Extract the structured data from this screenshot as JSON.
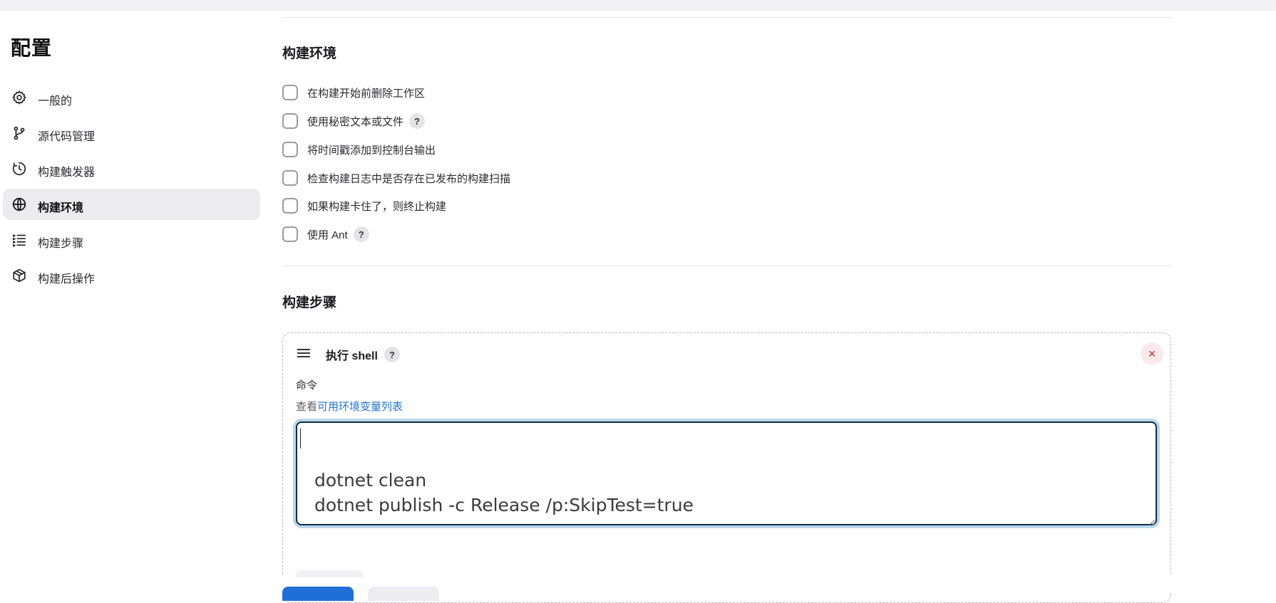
{
  "sidebar": {
    "title": "配置",
    "items": [
      {
        "label": "一般的",
        "icon": "gear-icon",
        "active": false
      },
      {
        "label": "源代码管理",
        "icon": "git-branch-icon",
        "active": false
      },
      {
        "label": "构建触发器",
        "icon": "clock-icon",
        "active": false
      },
      {
        "label": "构建环境",
        "icon": "globe-icon",
        "active": true
      },
      {
        "label": "构建步骤",
        "icon": "list-steps-icon",
        "active": false
      },
      {
        "label": "构建后操作",
        "icon": "package-icon",
        "active": false
      }
    ]
  },
  "build_env": {
    "title": "构建环境",
    "options": [
      {
        "label": "在构建开始前删除工作区",
        "checked": false,
        "help": false
      },
      {
        "label": "使用秘密文本或文件",
        "checked": false,
        "help": true
      },
      {
        "label": "将时间戳添加到控制台输出",
        "checked": false,
        "help": false
      },
      {
        "label": "检查构建日志中是否存在已发布的构建扫描",
        "checked": false,
        "help": false
      },
      {
        "label": "如果构建卡住了，则终止构建",
        "checked": false,
        "help": false
      },
      {
        "label": "使用 Ant",
        "checked": false,
        "help": true
      }
    ]
  },
  "build_steps": {
    "title": "构建步骤",
    "step": {
      "title": "执行 shell",
      "help": "?",
      "close": "×",
      "command_label": "命令",
      "env_prefix": "查看",
      "env_link": "可用环境变量列表",
      "command_value": "\ndotnet clean\ndotnet publish -c Release /p:SkipTest=true"
    }
  },
  "help_glyph": "?",
  "colors": {
    "accent": "#1f73d6",
    "active_nav_bg": "#ececf0",
    "danger": "#d0243a",
    "focus_ring": "#bcd6ea"
  }
}
